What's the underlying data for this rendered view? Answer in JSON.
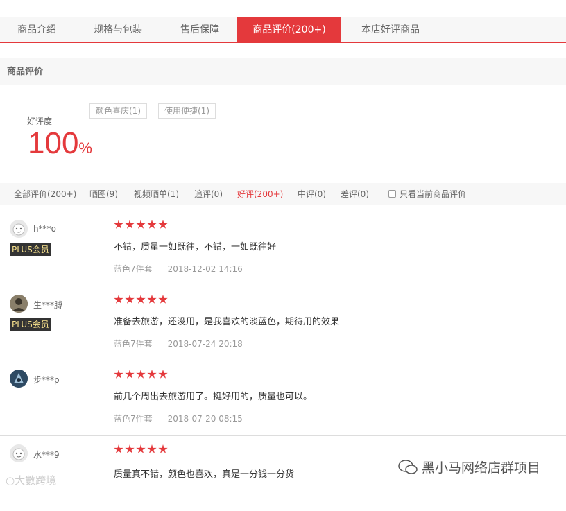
{
  "tabs": [
    {
      "label": "商品介绍",
      "active": false
    },
    {
      "label": "规格与包装",
      "active": false
    },
    {
      "label": "售后保障",
      "active": false
    },
    {
      "label": "商品评价(200+)",
      "active": true
    },
    {
      "label": "本店好评商品",
      "active": false
    }
  ],
  "section_title": "商品评价",
  "rating": {
    "label": "好评度",
    "value": "100",
    "unit": "%"
  },
  "tags": [
    "颜色喜庆(1)",
    "使用便捷(1)"
  ],
  "filters": [
    {
      "label": "全部评价(200+)",
      "active": false
    },
    {
      "label": "晒图(9)",
      "active": false
    },
    {
      "label": "视频晒单(1)",
      "active": false
    },
    {
      "label": "追评(0)",
      "active": false
    },
    {
      "label": "好评(200+)",
      "active": true
    },
    {
      "label": "中评(0)",
      "active": false
    },
    {
      "label": "差评(0)",
      "active": false
    }
  ],
  "only_current_label": "只看当前商品评价",
  "reviews": [
    {
      "user": "h***o",
      "badge": "PLUS会员",
      "stars": 5,
      "text": "不错，质量一如既往，不错，一如既往好",
      "variant": "蓝色7件套",
      "date": "2018-12-02 14:16",
      "avatar_color": "#e8e8e8"
    },
    {
      "user": "生***膊",
      "badge": "PLUS会员",
      "stars": 5,
      "text": "准备去旅游，还没用，是我喜欢的淡蓝色，期待用的效果",
      "variant": "蓝色7件套",
      "date": "2018-07-24 20:18",
      "avatar_color": "#6b6253"
    },
    {
      "user": "步***p",
      "badge": "",
      "stars": 5,
      "text": "前几个周出去旅游用了。挺好用的，质量也可以。",
      "variant": "蓝色7件套",
      "date": "2018-07-20 08:15",
      "avatar_color": "#2e4a63"
    },
    {
      "user": "水***9",
      "badge": "",
      "stars": 5,
      "text": "质量真不错，颜色也喜欢，真是一分钱一分货",
      "variant": "",
      "date": "",
      "avatar_color": "#e8e8e8"
    }
  ],
  "watermark_left": "大數跨境",
  "watermark_right": "黑小马网络店群项目",
  "colors": {
    "accent": "#e4393c"
  }
}
